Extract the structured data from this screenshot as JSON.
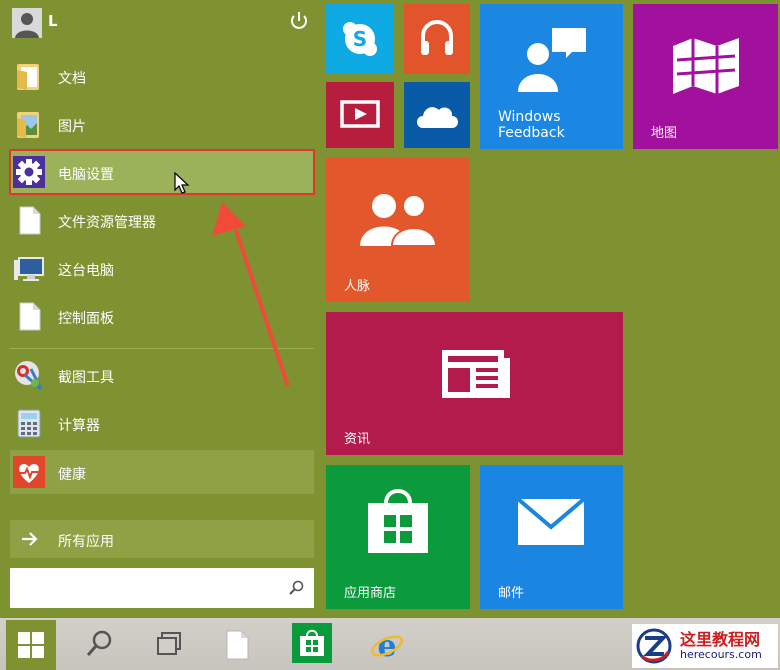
{
  "user": {
    "name": "L"
  },
  "menu": {
    "items": [
      {
        "label": "文档",
        "icon": "documents-folder-icon"
      },
      {
        "label": "图片",
        "icon": "pictures-folder-icon"
      },
      {
        "label": "电脑设置",
        "icon": "gear-icon",
        "selected": true
      },
      {
        "label": "文件资源管理器",
        "icon": "file-icon"
      },
      {
        "label": "这台电脑",
        "icon": "computer-icon"
      },
      {
        "label": "控制面板",
        "icon": "file-icon"
      },
      {
        "label": "截图工具",
        "icon": "scissors-icon"
      },
      {
        "label": "计算器",
        "icon": "calculator-icon"
      },
      {
        "label": "健康",
        "icon": "heart-pulse-icon"
      }
    ],
    "all_apps": "所有应用",
    "search": {
      "value": "",
      "placeholder": ""
    }
  },
  "tiles": {
    "feedback": "Windows Feedback",
    "feedback_line1": "Windows",
    "feedback_line2": "Feedback",
    "maps": "地图",
    "people": "人脉",
    "news": "资讯",
    "store": "应用商店",
    "mail": "邮件"
  },
  "watermark": {
    "title": "这里教程网",
    "url": "herecours.com"
  },
  "colors": {
    "start_bg": "#7e9232",
    "highlight_border": "#e0372d",
    "skype": "#0fa9e4",
    "music": "#e2542b",
    "video": "#b71d3c",
    "onedrive": "#0a5ba7",
    "feedback": "#1b87e3",
    "maps": "#a1119e",
    "people": "#e2572b",
    "news": "#b41b4d",
    "store": "#0b9a3c",
    "mail": "#1a86e1"
  }
}
